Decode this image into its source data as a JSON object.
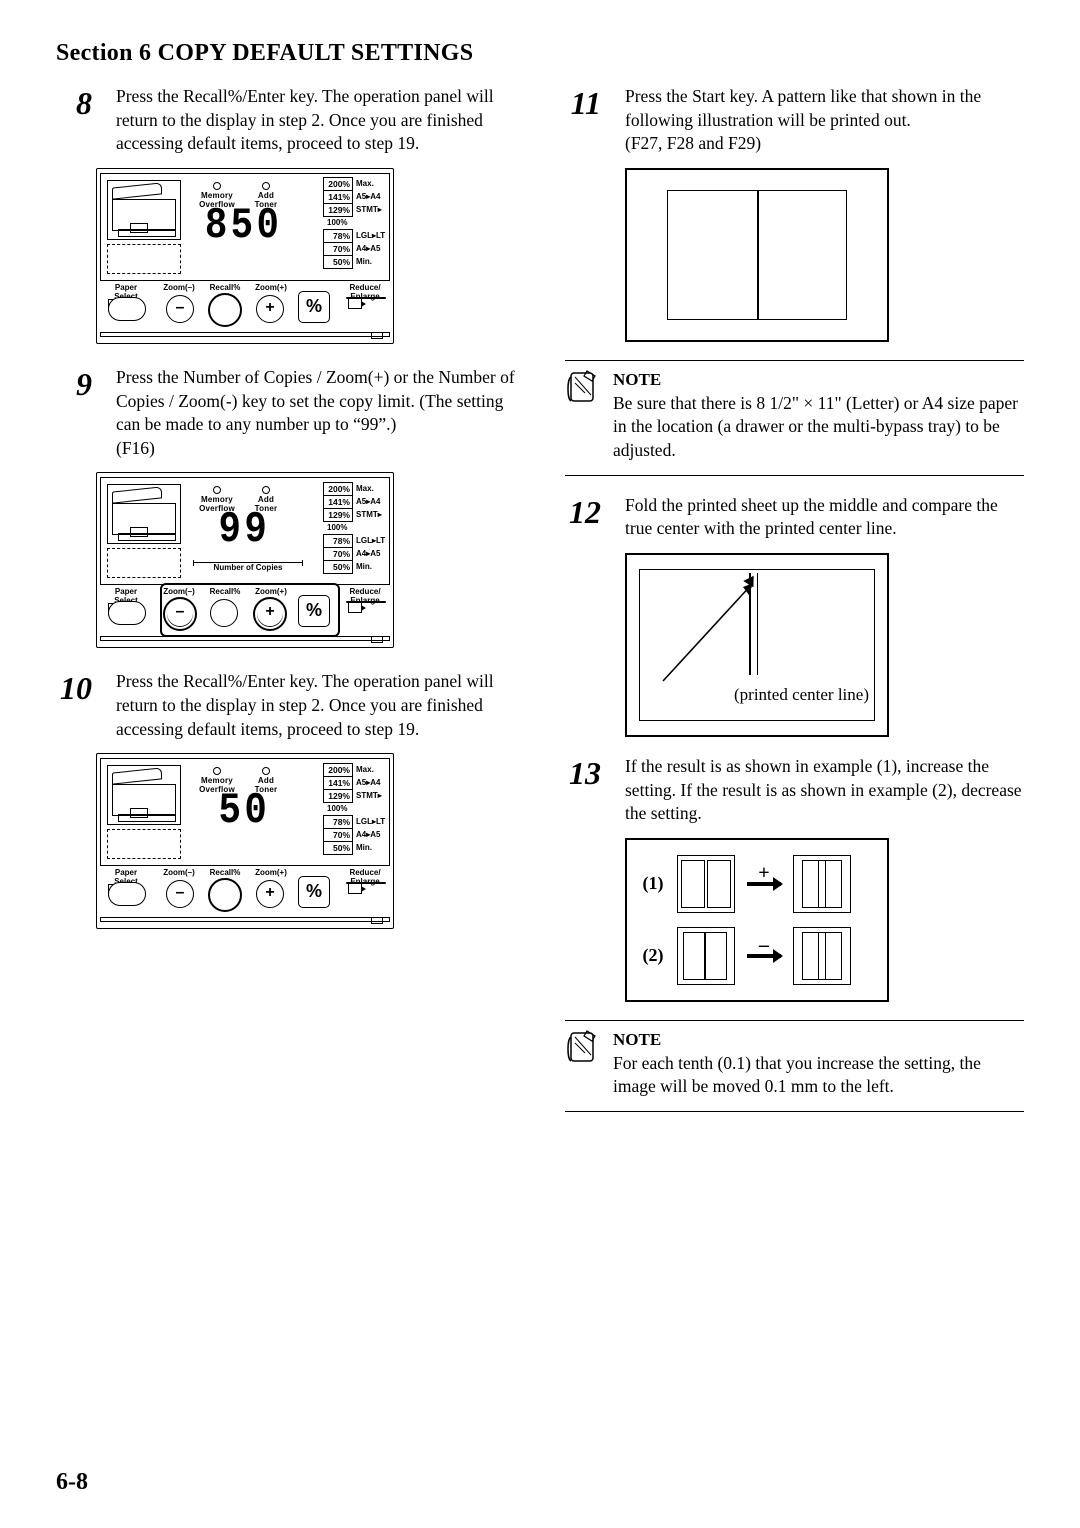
{
  "section_title": "Section 6  COPY DEFAULT SETTINGS",
  "page_number": "6-8",
  "panel_labels": {
    "memory_overflow": "Memory\nOverflow",
    "add_toner": "Add\nToner",
    "num_of_copies": "Number of Copies",
    "paper_select": "Paper\nSelect",
    "zoom_minus": "Zoom(–)",
    "recall": "Recall%",
    "zoom_plus": "Zoom(+)",
    "reduce_enlarge": "Reduce/\nEnlarge",
    "percent": "%",
    "minus": "–",
    "plus": "+"
  },
  "ratio_list": [
    {
      "box": "200%",
      "lbl": "Max."
    },
    {
      "box": "141%",
      "lbl": "A5▸A4"
    },
    {
      "box": "129%",
      "lbl": "STMT▸"
    },
    {
      "box": "",
      "lbl": "100%"
    },
    {
      "box": "78%",
      "lbl": "LGL▸LT"
    },
    {
      "box": "70%",
      "lbl": "A4▸A5"
    },
    {
      "box": "50%",
      "lbl": "Min."
    }
  ],
  "steps": {
    "s8": {
      "num": "8",
      "text": "Press the Recall%/Enter key. The operation panel will return to the display in step 2. Once you are finished accessing default items, proceed to step 19."
    },
    "s9": {
      "num": "9",
      "text": "Press the Number of Copies / Zoom(+) or the Number of Copies / Zoom(-) key to set the copy limit. (The setting can be made to any number up to “99”.)\n(F16)"
    },
    "s10": {
      "num": "10",
      "text": "Press the Recall%/Enter key. The operation panel will return to the display in step 2. Once you are finished accessing default items, proceed to step 19."
    },
    "s11": {
      "num": "11",
      "text": "Press the Start key. A pattern like that shown in the following illustration will be printed out.\n(F27, F28 and F29)"
    },
    "s12": {
      "num": "12",
      "text": "Fold the printed sheet up the middle and compare the true center with the printed center line."
    },
    "s13": {
      "num": "13",
      "text": "If the result is as shown in example (1), increase the setting. If the result is as shown in example (2), decrease the setting."
    }
  },
  "panels": {
    "p8": {
      "digits": "850",
      "highlight": "recall_round",
      "show_copies_label": false
    },
    "p9": {
      "digits": "99",
      "highlight": "zoom_group",
      "show_copies_label": true
    },
    "p10": {
      "digits": "50",
      "highlight": "recall_round",
      "show_copies_label": false
    }
  },
  "notes": {
    "n1": {
      "label": "NOTE",
      "text": "Be sure that there is 8 1/2\" × 11\" (Letter) or A4 size paper in the location (a drawer or the multi-bypass tray) to be adjusted."
    },
    "n2": {
      "label": "NOTE",
      "text": "For each tenth (0.1) that you increase the setting, the image will be moved 0.1 mm to the left."
    }
  },
  "illus12_label": "(printed center line)",
  "illus13": {
    "row1_num": "(1)",
    "row1_sign": "+",
    "row2_num": "(2)",
    "row2_sign": "–"
  }
}
